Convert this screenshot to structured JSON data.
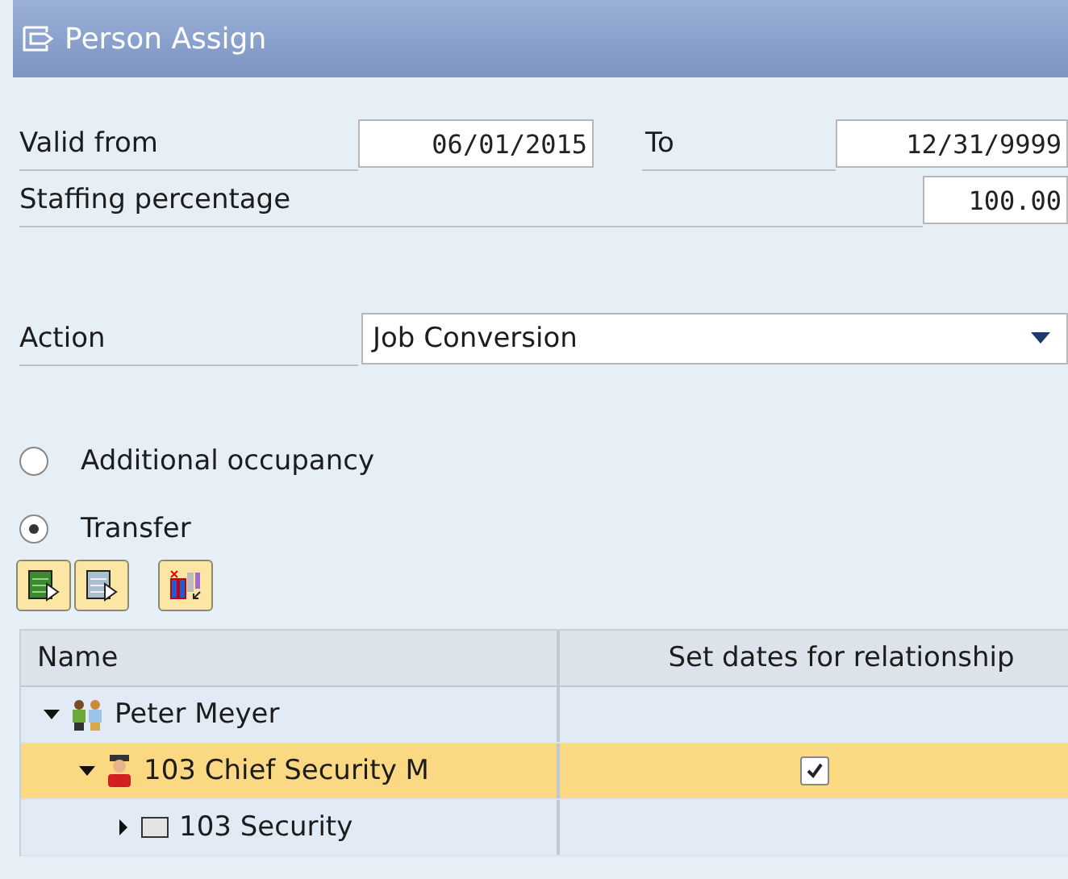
{
  "window": {
    "title": "Person Assign"
  },
  "validity": {
    "from_label": "Valid from",
    "from_value": "06/01/2015",
    "to_label": "To",
    "to_value": "12/31/9999"
  },
  "staffing": {
    "label": "Staffing percentage",
    "value": "100.00"
  },
  "action": {
    "label": "Action",
    "value": "Job Conversion"
  },
  "options": [
    {
      "label": "Additional occupancy",
      "selected": false
    },
    {
      "label": "Transfer",
      "selected": true
    }
  ],
  "toolbar": [
    {
      "kind": "expand"
    },
    {
      "kind": "collapse"
    },
    {
      "kind": "columns"
    }
  ],
  "table": {
    "columns": [
      "Name",
      "Set dates for relationship"
    ],
    "rows": [
      {
        "kind": "person",
        "name": "Peter Meyer",
        "expanded": true,
        "selected": false,
        "children": [
          {
            "kind": "position",
            "name": "103 Chief Security M",
            "expanded": true,
            "selected": true,
            "checked": true,
            "children": [
              {
                "kind": "org-unit",
                "name": "103 Security",
                "expanded": false,
                "selected": false
              }
            ]
          }
        ]
      }
    ]
  }
}
